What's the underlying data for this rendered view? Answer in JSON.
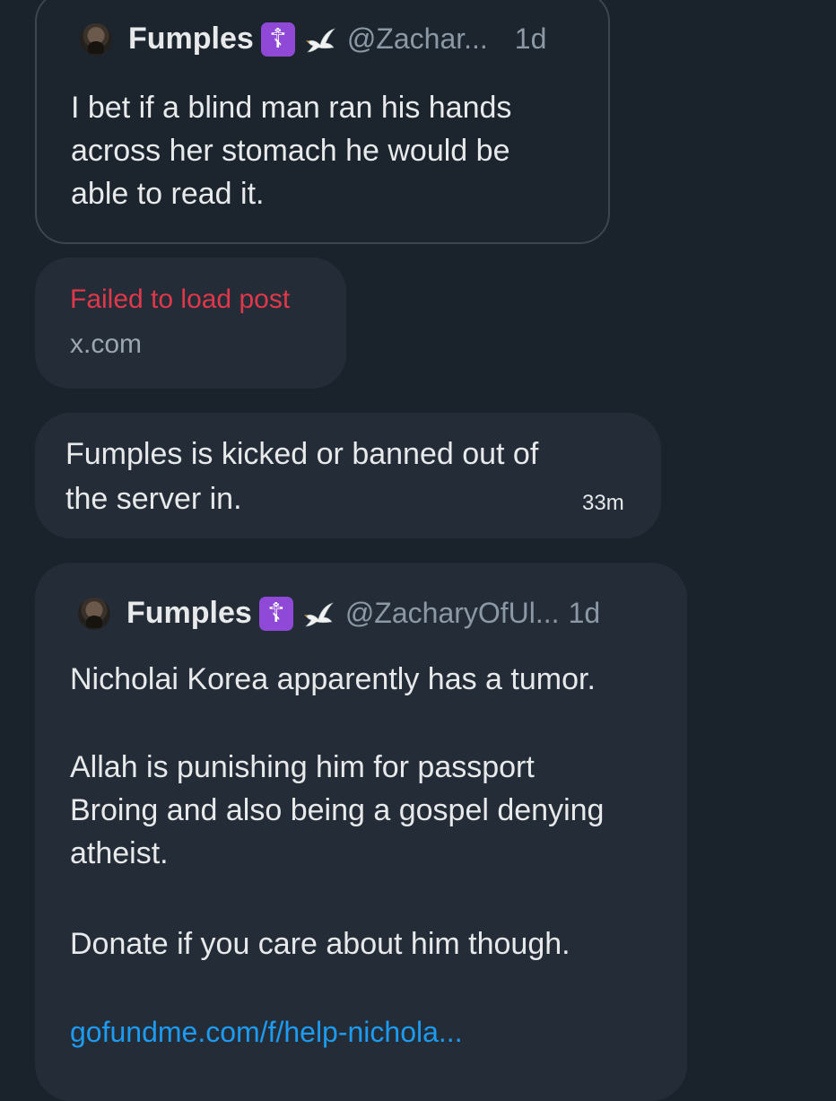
{
  "quoted_post_1": {
    "author_name": "Fumples",
    "cross_emoji": "☦",
    "dove_icon": "dove-icon",
    "handle": "@Zachar...",
    "age": "1d",
    "text_lines": [
      "I bet if a blind man ran his hands",
      "across her stomach he would be",
      "able to read it."
    ]
  },
  "failed_post": {
    "error_text": "Failed to load post",
    "domain": "x.com",
    "error_color": "#e0384a"
  },
  "message": {
    "text_lines": [
      "Fumples is kicked or banned out of",
      "the server in."
    ],
    "time": "33m"
  },
  "message_with_quote": {
    "author_name": "Fumples",
    "cross_emoji": "☦",
    "dove_icon": "dove-icon",
    "handle": "@ZacharyOfUl...",
    "age": "1d",
    "paragraph_1": "Nicholai Korea apparently has a tumor.",
    "paragraph_2_lines": [
      "Allah is punishing him for passport",
      "Broing and also being a gospel denying",
      "atheist."
    ],
    "paragraph_3": "Donate if you care about him though.",
    "link_text": "gofundme.com/f/help-nichola..."
  },
  "colors": {
    "background": "#1a222b",
    "bubble": "#242d37",
    "link": "#1d9bf0",
    "muted_text": "#8b98a5"
  }
}
